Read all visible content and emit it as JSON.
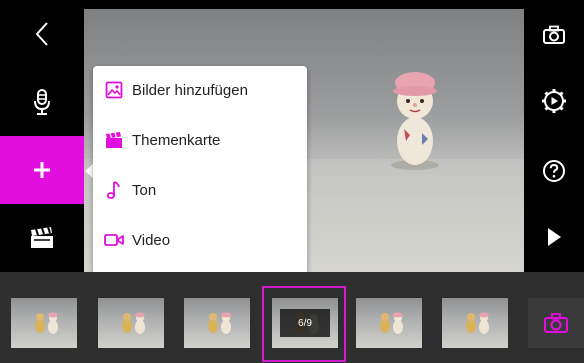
{
  "menu": {
    "items": [
      {
        "label": "Bilder hinzufügen",
        "icon": "image-icon"
      },
      {
        "label": "Themenkarte",
        "icon": "theme-card-icon"
      },
      {
        "label": "Ton",
        "icon": "music-note-icon"
      },
      {
        "label": "Video",
        "icon": "video-camera-icon"
      }
    ]
  },
  "timeline": {
    "selected_counter": "6/9"
  },
  "colors": {
    "accent": "#e20ee0",
    "background": "#000000",
    "timeline": "#2e2e2e"
  }
}
